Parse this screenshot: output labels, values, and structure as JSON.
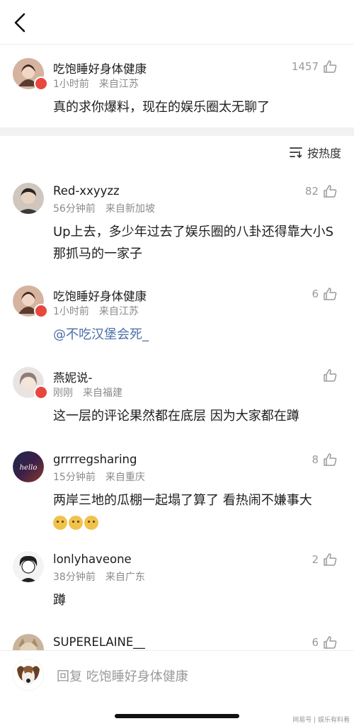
{
  "header": {
    "back_icon": "chevron-left-icon"
  },
  "top_comment": {
    "username": "吃饱睡好身体健康",
    "time": "1小时前",
    "location": "来自江苏",
    "likes": "1457",
    "text": "真的求你爆料，现在的娱乐圈太无聊了"
  },
  "sort": {
    "label": "按热度",
    "icon": "sort-icon"
  },
  "comments": [
    {
      "username": "Red-xxyyzz",
      "time": "56分钟前",
      "location": "来自新加坡",
      "likes": "82",
      "text": "Up上去，多少年过去了娱乐圈的八卦还得靠大小S那抓马的一家子"
    },
    {
      "username": "吃饱睡好身体健康",
      "time": "1小时前",
      "location": "来自江苏",
      "likes": "6",
      "text": "@不吃汉堡会死_"
    },
    {
      "username": "燕妮说-",
      "time": "刚刚",
      "location": "来自福建",
      "likes": "",
      "text": "这一层的评论果然都在底层 因为大家都在蹲"
    },
    {
      "username": "grrrregsharing",
      "time": "15分钟前",
      "location": "来自重庆",
      "likes": "8",
      "text": "两岸三地的瓜棚一起塌了算了 看热闹不嫌事大"
    },
    {
      "username": "lonlyhaveone",
      "time": "38分钟前",
      "location": "来自广东",
      "likes": "2",
      "text": "蹲"
    },
    {
      "username": "SUPERELAINE__",
      "time": "",
      "location": "",
      "likes": "6",
      "text": ""
    }
  ],
  "reply_bar": {
    "placeholder": "回复 吃饱睡好身体健康"
  },
  "watermark": "网易号 | 娱乐有料看"
}
